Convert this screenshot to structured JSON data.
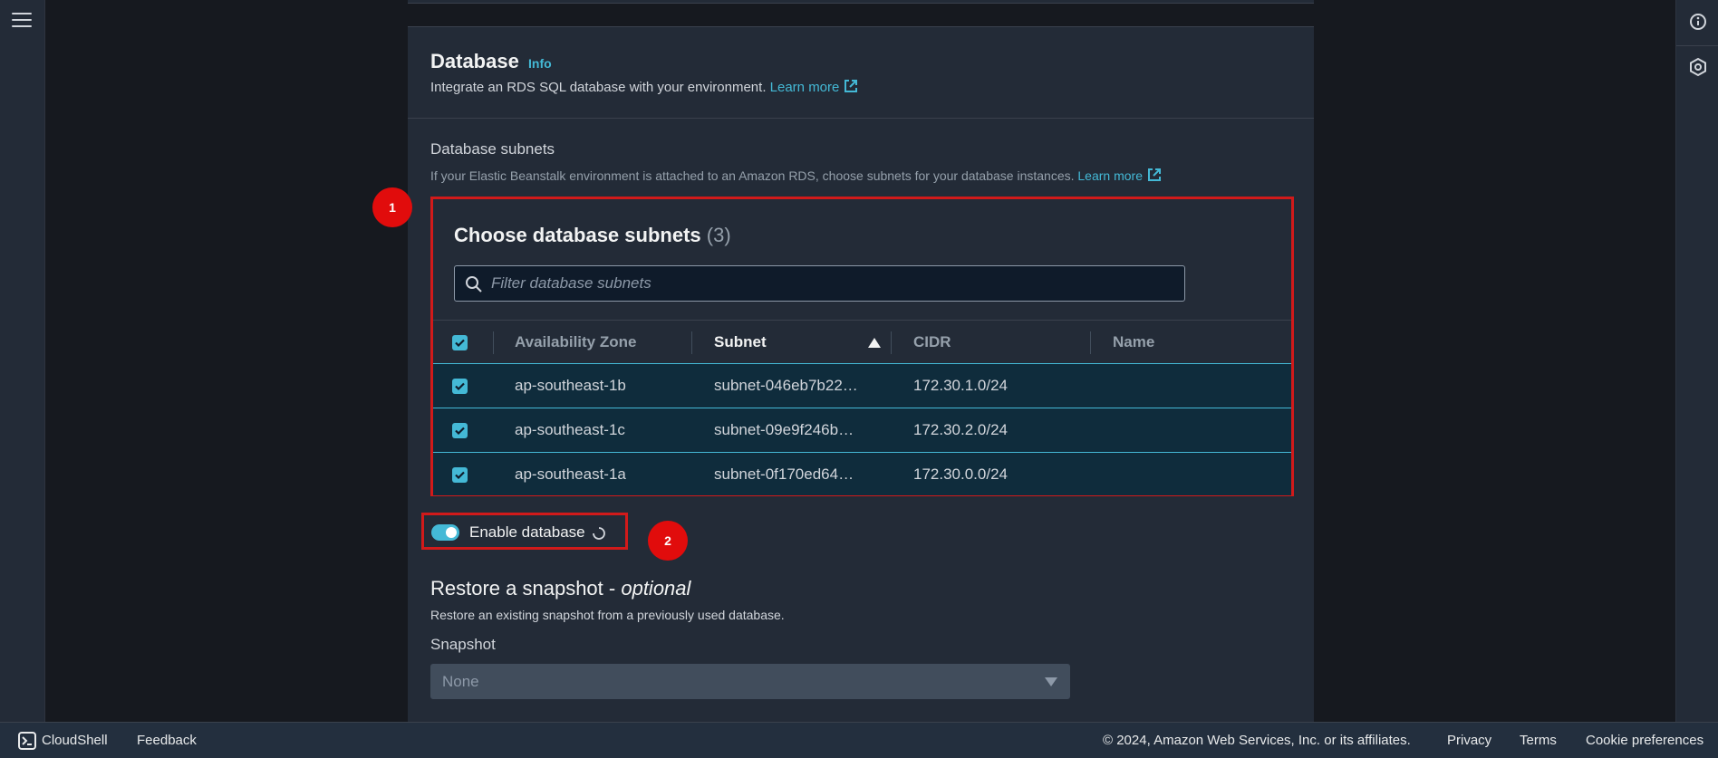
{
  "database": {
    "title": "Database",
    "info_label": "Info",
    "subtitle": "Integrate an RDS SQL database with your environment.",
    "learn_more": "Learn more"
  },
  "subnets": {
    "label": "Database subnets",
    "description": "If your Elastic Beanstalk environment is attached to an Amazon RDS, choose subnets for your database instances.",
    "learn_more": "Learn more",
    "box_title": "Choose database subnets",
    "count": "(3)",
    "filter_placeholder": "Filter database subnets",
    "columns": [
      "Availability Zone",
      "Subnet",
      "CIDR",
      "Name"
    ],
    "rows": [
      {
        "zone": "ap-southeast-1b",
        "subnet": "subnet-046eb7b22…",
        "cidr": "172.30.1.0/24",
        "name": ""
      },
      {
        "zone": "ap-southeast-1c",
        "subnet": "subnet-09e9f246b…",
        "cidr": "172.30.2.0/24",
        "name": ""
      },
      {
        "zone": "ap-southeast-1a",
        "subnet": "subnet-0f170ed64…",
        "cidr": "172.30.0.0/24",
        "name": ""
      }
    ]
  },
  "enable": {
    "label": "Enable database"
  },
  "annotations": {
    "badge1": "1",
    "badge2": "2"
  },
  "restore": {
    "title": "Restore a snapshot - ",
    "title_optional": "optional",
    "description": "Restore an existing snapshot from a previously used database.",
    "snapshot_label": "Snapshot",
    "snapshot_value": "None"
  },
  "footer": {
    "cloudshell": "CloudShell",
    "feedback": "Feedback",
    "copyright": "© 2024, Amazon Web Services, Inc. or its affiliates.",
    "privacy": "Privacy",
    "terms": "Terms",
    "cookies": "Cookie preferences"
  },
  "colors": {
    "accent": "#44b9d6",
    "highlight": "#d11a1a",
    "badge": "#e10c0c",
    "selected_row": "#0f2c3c"
  },
  "icons": [
    "hamburger-icon",
    "info-circle-icon",
    "hexagon-icon",
    "external-link-icon",
    "search-icon",
    "sort-ascending-icon",
    "checkbox-checked-icon",
    "spinner-icon",
    "caret-down-icon",
    "cloudshell-icon"
  ]
}
